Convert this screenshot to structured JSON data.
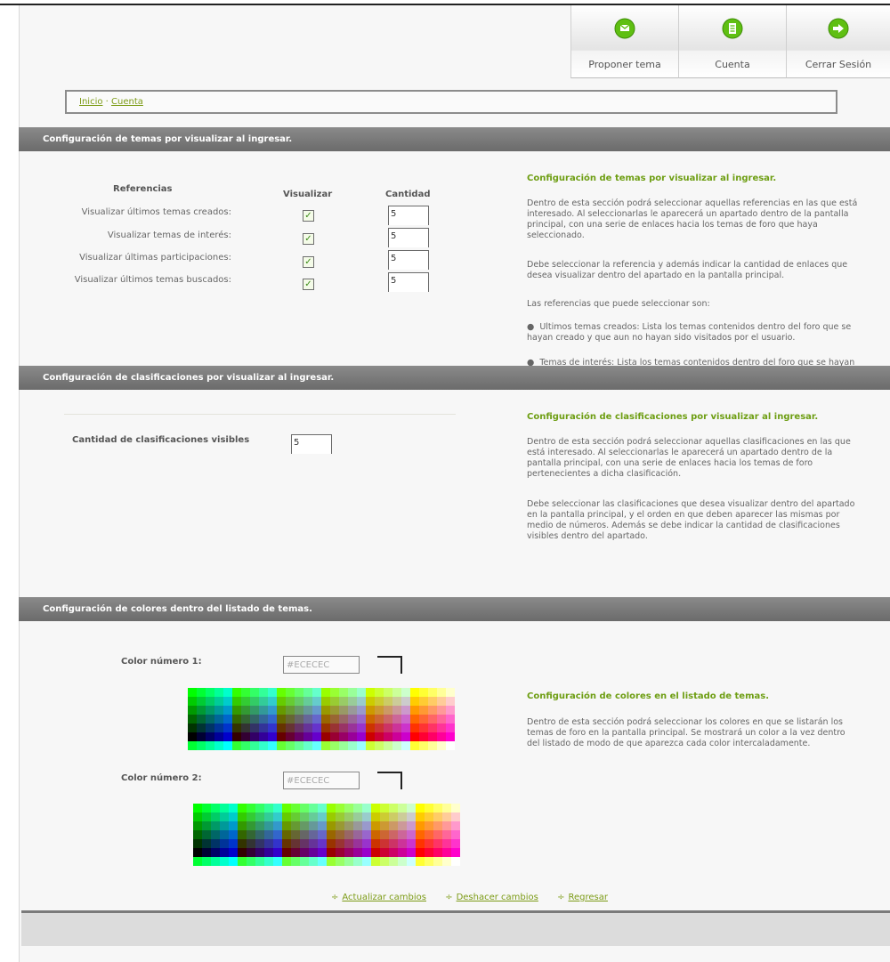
{
  "nav": {
    "items": [
      {
        "label": "Proponer tema",
        "icon": "propose-topic-icon"
      },
      {
        "label": "Cuenta",
        "icon": "account-icon"
      },
      {
        "label": "Cerrar Sesión",
        "icon": "logout-icon"
      }
    ]
  },
  "breadcrumb": {
    "home": "Inicio",
    "separator": "·",
    "current": "Cuenta"
  },
  "section_topics": {
    "header": "Configuración de temas por visualizar al ingresar.",
    "col_references": "Referencias",
    "col_visualize": "Visualizar",
    "col_quantity": "Cantidad",
    "rows": [
      {
        "label": "Visualizar últimos temas creados:",
        "checked": true,
        "quantity": "5"
      },
      {
        "label": "Visualizar temas de interés:",
        "checked": true,
        "quantity": "5"
      },
      {
        "label": "Visualizar últimas participaciones:",
        "checked": true,
        "quantity": "5"
      },
      {
        "label": "Visualizar últimos temas buscados:",
        "checked": true,
        "quantity": "5"
      }
    ],
    "info_title": "Configuración de temas por visualizar al ingresar.",
    "info_p1": "Dentro de esta sección podrá seleccionar aquellas referencias en las que está interesado. Al seleccionarlas le aparecerá un apartado dentro de la pantalla principal, con una serie de enlaces hacia los temas de foro que haya seleccionado.",
    "info_p2": "Debe seleccionar la referencia y además indicar la cantidad de enlaces que desea visualizar dentro del apartado en la pantalla principal.",
    "info_p3": "Las referencias que puede seleccionar son:",
    "bullet1": "Ultimos temas creados: Lista los temas contenidos dentro del foro que se hayan creado y que aun no hayan sido visitados por el usuario.",
    "bullet2": "Temas de interés: Lista los temas contenidos dentro del foro que se hayan"
  },
  "section_classifications": {
    "header": "Configuración de clasificaciones por visualizar al ingresar.",
    "label": "Cantidad de  clasificaciones visibles",
    "quantity": "5",
    "info_title": "Configuración de clasificaciones por visualizar al ingresar.",
    "info_p1": "Dentro de esta sección podrá seleccionar aquellas clasificaciones en las que está interesado. Al seleccionarlas le aparecerá un apartado dentro de la pantalla principal, con una serie de enlaces hacia los temas de foro pertenecientes a dicha clasificación.",
    "info_p2": "Debe seleccionar las clasificaciones que desea visualizar dentro del apartado en la pantalla principal, y el orden en que deben aparecer las mismas por medio de números. Además se debe indicar la cantidad de clasificaciones visibles dentro del apartado."
  },
  "section_colors": {
    "header": "Configuración de colores dentro del listado de temas.",
    "color1_label": "Color número 1:",
    "color1_value": "#ECECEC",
    "color2_label": "Color número 2:",
    "color2_value": "#ECECEC",
    "info_title": "Configuración de colores en el listado de temas.",
    "info_p1": "Dentro de esta sección podrá seleccionar los colores en que se listarán los temas de foro en la pantalla principal. Se mostrará un color a la vez dentro del listado de modo de que aparezca cada color intercaladamente."
  },
  "actions": {
    "update": "Actualizar cambios",
    "undo": "Deshacer cambios",
    "back": "Regresar"
  },
  "colors": {
    "accent_green": "#7c9b16",
    "header_gray": "#7a7a7a"
  }
}
